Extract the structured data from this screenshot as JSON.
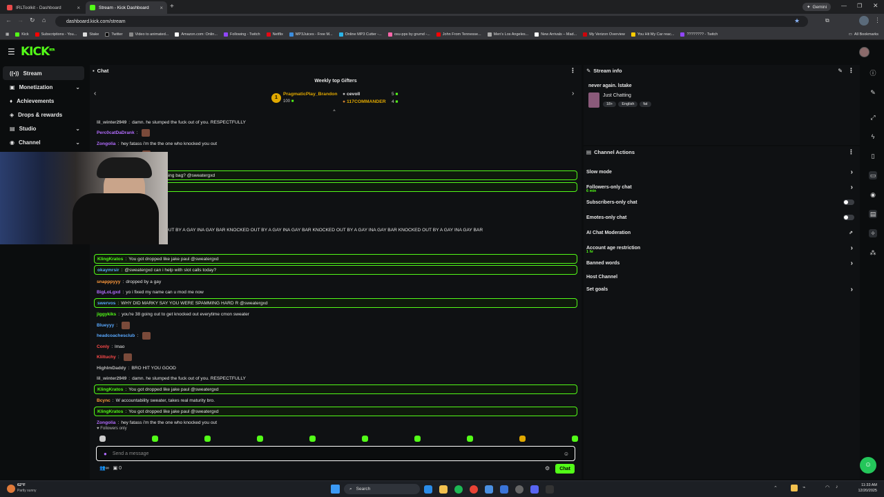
{
  "browser": {
    "tabs": [
      {
        "title": "IRLToolkit - Dashboard",
        "active": false,
        "color": "#e84a4a"
      },
      {
        "title": "Stream - Kick Dashboard",
        "active": true,
        "color": "#53fc18"
      }
    ],
    "new_tab": "+",
    "url": "dashboard.kick.com/stream",
    "gemini_label": "Gemini",
    "bookmarks": [
      "Kick",
      "Subscriptions - You...",
      "Stake",
      "Twitter",
      "Video to animated...",
      "Amazon.com: Onlin...",
      "Following - Twitch",
      "Netflix",
      "MP3Juices - Free M...",
      "Online MP3 Cutter -...",
      "osu-pps by grumd -...",
      "John From Tennesse...",
      "Men's Los Angeles...",
      "New Arrivals – Mad...",
      "My Verizon Overview",
      "You Hit My Car reac...",
      "???????? - Twitch"
    ],
    "all_bookmarks": "All Bookmarks"
  },
  "kick": {
    "logo": "KICK",
    "logo_sup": "BETA"
  },
  "sidebar": {
    "items": [
      {
        "label": "Stream",
        "icon": "broadcast-icon",
        "active": true,
        "chevron": false
      },
      {
        "label": "Monetization",
        "icon": "dollar-icon",
        "active": false,
        "chevron": true
      },
      {
        "label": "Achievements",
        "icon": "trophy-icon",
        "active": false,
        "chevron": false
      },
      {
        "label": "Drops & rewards",
        "icon": "gift-icon",
        "active": false,
        "chevron": false
      },
      {
        "label": "Studio",
        "icon": "studio-icon",
        "active": false,
        "chevron": true
      },
      {
        "label": "Channel",
        "icon": "channel-icon",
        "active": false,
        "chevron": true
      }
    ]
  },
  "chat": {
    "title": "Chat",
    "gifters_title": "Weekly top Gifters",
    "gifters": [
      {
        "rank": "1",
        "name": "PragmaticPlay_Brandon",
        "count": "100"
      },
      {
        "name": "cevoll",
        "count": "5"
      },
      {
        "name": "117COMMANDER",
        "count": "4"
      }
    ],
    "messages": [
      {
        "user": "lil_winter2949",
        "color": "#bdbdbd",
        "text": "damn. he slumped the fuck out of you. RESPECTFULLY",
        "hl": false
      },
      {
        "user": "Perc0catDaDrank",
        "color": "#b36cff",
        "text": "",
        "hl": false,
        "emote": true
      },
      {
        "user": "Zongolia",
        "color": "#b36cff",
        "text": "hey fatass i'm the the one who knocked you out",
        "hl": false
      },
      {
        "user": "headcoachesclub",
        "color": "#5aa9ff",
        "text": "",
        "hl": false,
        "emote": true
      },
      {
        "user": "",
        "color": "#53fc18",
        "text": "a have the fighting skills of a punching bag? @sweatergxd",
        "hl": true
      },
      {
        "user": "",
        "color": "#53fc18",
        "text": "WN7CagZ @sweatergxd",
        "hl": true
      },
      {
        "user": "",
        "color": "#bdbdbd",
        "text": "ere gay",
        "hl": false
      },
      {
        "user": "",
        "color": "#bdbdbd",
        "text": "n's?",
        "hl": false
      },
      {
        "user": "",
        "color": "#bdbdbd",
        "text": "A GAY INA GAY BAR KNOCKED OUT BY A GAY INA GAY BAR KNOCKED OUT BY A GAY INA GAY BAR KNOCKED OUT BY A GAY INA GAY BAR KNOCKED OUT BY A GAY INA GAY BAR",
        "hl": false
      },
      {
        "user": "",
        "color": "#bdbdbd",
        "text": "Y BAR",
        "hl": false
      },
      {
        "user": "KlingKratos",
        "color": "#53fc18",
        "text": "You got dropped like jake paul      @sweatergxd",
        "hl": true
      },
      {
        "user": "okaymrsir",
        "color": "#5aa9ff",
        "text": "@sweatergxd can i help with slot calls today?",
        "hl": true
      },
      {
        "user": "snapppyyy",
        "color": "#ff9a3c",
        "text": "dropped by a gay",
        "hl": false
      },
      {
        "user": "BigLoLgxd",
        "color": "#b36cff",
        "text": "yo i fixed my name can u mod me now",
        "hl": false
      },
      {
        "user": "swervos",
        "color": "#5aa9ff",
        "text": "WHY DID MARKY SAY YOU WERE SPAMMING HARD R @sweatergxd",
        "hl": true
      },
      {
        "user": "jiggykiks",
        "color": "#53fc18",
        "text": "you're 38 going out to get knocked out everytime      cmon sweater",
        "hl": false
      },
      {
        "user": "Blueyyy",
        "color": "#5aa9ff",
        "text": "",
        "hl": false,
        "emote": true
      },
      {
        "user": "headcoachesclub",
        "color": "#5aa9ff",
        "text": "",
        "hl": false,
        "emote": true
      },
      {
        "user": "Conly",
        "color": "#ff4a4a",
        "text": "lmao",
        "hl": false
      },
      {
        "user": "Kliltuchy",
        "color": "#ff4a4a",
        "text": "",
        "hl": false,
        "emote": true
      },
      {
        "user": "HighImDaddy",
        "color": "#bdbdbd",
        "text": "BRO HIT YOU GOOD",
        "hl": false
      },
      {
        "user": "lil_winter2949",
        "color": "#bdbdbd",
        "text": "damn. he slumped the fuck out of you. RESPECTFULLY",
        "hl": false
      },
      {
        "user": "KlingKratos",
        "color": "#53fc18",
        "text": "You got dropped like jake paul      @sweatergxd",
        "hl": true
      },
      {
        "user": "Bcync",
        "color": "#ff9a3c",
        "text": "W accountability sweater, takes real maturity bro.",
        "hl": false
      },
      {
        "user": "KlingKratos",
        "color": "#53fc18",
        "text": "You got dropped like jake paul      @sweatergxd",
        "hl": true
      },
      {
        "user": "Zongolia",
        "color": "#b36cff",
        "text": "hey fatass i'm the the one who knocked you out",
        "hl": false
      }
    ],
    "followers_only": "Followers only",
    "placeholder": "Send a message",
    "chat_button": "Chat",
    "viewer_count": "0"
  },
  "stream_info": {
    "title": "Stream info",
    "stream_title": "never again. lstake",
    "category": "Just Chatting",
    "tags": [
      "18+",
      "English",
      "fat"
    ]
  },
  "channel_actions": {
    "title": "Channel Actions",
    "rows": [
      {
        "label": "Slow mode",
        "sub": "",
        "control": "chevron"
      },
      {
        "label": "Followers-only chat",
        "sub": "6 min",
        "control": "chevron"
      },
      {
        "label": "Subscribers-only chat",
        "sub": "",
        "control": "toggle"
      },
      {
        "label": "Emotes-only chat",
        "sub": "",
        "control": "toggle"
      },
      {
        "label": "AI Chat Moderation",
        "sub": "",
        "control": "external"
      },
      {
        "label": "Account age restriction",
        "sub": "1 hr",
        "control": "chevron"
      },
      {
        "label": "Banned words",
        "sub": "",
        "control": "chevron"
      },
      {
        "label": "Host Channel",
        "sub": "",
        "control": "none"
      },
      {
        "label": "Set goals",
        "sub": "",
        "control": "chevron"
      }
    ]
  },
  "taskbar": {
    "weather_temp": "62°F",
    "weather_desc": "Partly sunny",
    "search": "Search",
    "time": "11:33 AM",
    "date": "12/20/2025"
  }
}
